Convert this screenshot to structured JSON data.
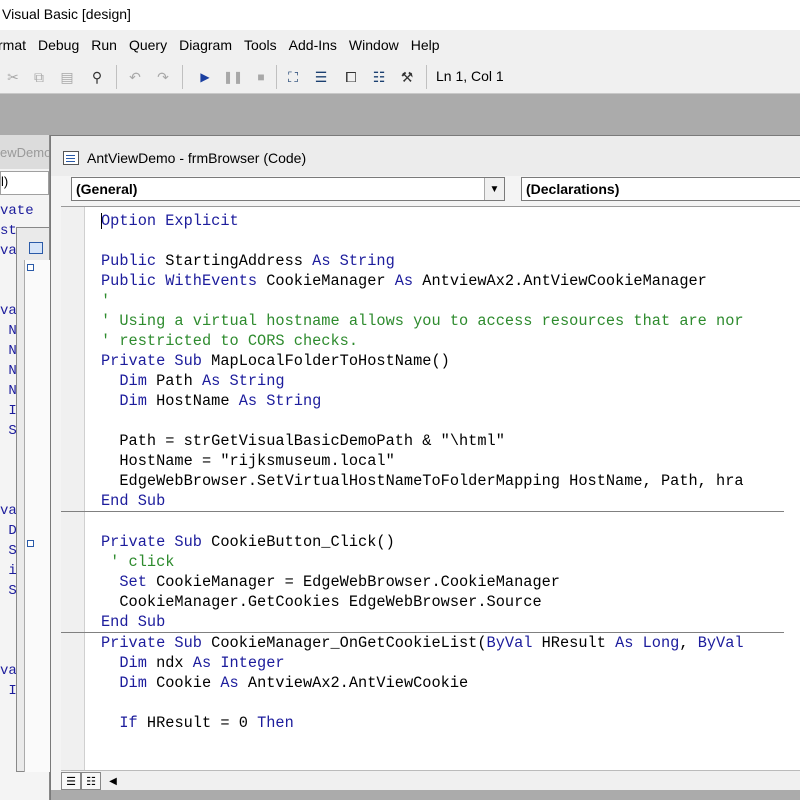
{
  "app": {
    "title": "Visual Basic [design]"
  },
  "menu": [
    "rmat",
    "Debug",
    "Run",
    "Query",
    "Diagram",
    "Tools",
    "Add-Ins",
    "Window",
    "Help"
  ],
  "toolbar": {
    "status": "Ln 1, Col 1",
    "icons": [
      "cut-icon",
      "copy-icon",
      "paste-icon",
      "find-icon",
      "undo-icon",
      "redo-icon",
      "run-icon",
      "pause-icon",
      "stop-icon",
      "project-explorer-icon",
      "properties-window-icon",
      "form-layout-icon",
      "object-browser-icon",
      "toolbox-icon"
    ]
  },
  "bg_window": {
    "title": "ewDemo",
    "combo": "l)",
    "lines": [
      "vate",
      "st",
      "va",
      "",
      "",
      "va",
      " N",
      " N",
      " N",
      " N",
      " I",
      " S",
      "",
      "",
      "",
      "va",
      " D",
      " S",
      " i",
      " S",
      "",
      "",
      "",
      "va",
      " I"
    ]
  },
  "code_window": {
    "title": "AntViewDemo - frmBrowser (Code)",
    "object_combo": "(General)",
    "procedure_combo": "(Declarations)"
  },
  "code_lines": [
    [
      [
        "kw",
        "Option Explicit"
      ]
    ],
    [],
    [
      [
        "kw",
        "Public "
      ],
      [
        "tx",
        "StartingAddress "
      ],
      [
        "kw",
        "As String"
      ]
    ],
    [
      [
        "kw",
        "Public WithEvents "
      ],
      [
        "tx",
        "CookieManager "
      ],
      [
        "kw",
        "As "
      ],
      [
        "tx",
        "AntviewAx2.AntViewCookieManager"
      ]
    ],
    [
      [
        "cm",
        "'"
      ]
    ],
    [
      [
        "cm",
        "' Using a virtual hostname allows you to access resources that are nor"
      ]
    ],
    [
      [
        "cm",
        "' restricted to CORS checks."
      ]
    ],
    [
      [
        "kw",
        "Private Sub "
      ],
      [
        "tx",
        "MapLocalFolderToHostName()"
      ]
    ],
    [
      [
        "tx",
        "  "
      ],
      [
        "kw",
        "Dim "
      ],
      [
        "tx",
        "Path "
      ],
      [
        "kw",
        "As String"
      ]
    ],
    [
      [
        "tx",
        "  "
      ],
      [
        "kw",
        "Dim "
      ],
      [
        "tx",
        "HostName "
      ],
      [
        "kw",
        "As String"
      ]
    ],
    [],
    [
      [
        "tx",
        "  Path = strGetVisualBasicDemoPath & \"\\html\""
      ]
    ],
    [
      [
        "tx",
        "  HostName = \"rijksmuseum.local\""
      ]
    ],
    [
      [
        "tx",
        "  EdgeWebBrowser.SetVirtualHostNameToFolderMapping HostName, Path, hra"
      ]
    ],
    [
      [
        "kw",
        "End Sub"
      ]
    ],
    [
      "SEP"
    ],
    [],
    [
      [
        "kw",
        "Private Sub "
      ],
      [
        "tx",
        "CookieButton_Click()"
      ]
    ],
    [
      [
        "cm",
        " ' click"
      ]
    ],
    [
      [
        "tx",
        "  "
      ],
      [
        "kw",
        "Set "
      ],
      [
        "tx",
        "CookieManager = EdgeWebBrowser.CookieManager"
      ]
    ],
    [
      [
        "tx",
        "  CookieManager.GetCookies EdgeWebBrowser.Source"
      ]
    ],
    [
      [
        "kw",
        "End Sub"
      ]
    ],
    [
      "SEP"
    ],
    [
      [
        "kw",
        "Private Sub "
      ],
      [
        "tx",
        "CookieManager_OnGetCookieList("
      ],
      [
        "kw",
        "ByVal "
      ],
      [
        "tx",
        "HResult "
      ],
      [
        "kw",
        "As Long"
      ],
      [
        "tx",
        ", "
      ],
      [
        "kw",
        "ByVal"
      ]
    ],
    [
      [
        "tx",
        "  "
      ],
      [
        "kw",
        "Dim "
      ],
      [
        "tx",
        "ndx "
      ],
      [
        "kw",
        "As Integer"
      ]
    ],
    [
      [
        "tx",
        "  "
      ],
      [
        "kw",
        "Dim "
      ],
      [
        "tx",
        "Cookie "
      ],
      [
        "kw",
        "As "
      ],
      [
        "tx",
        "AntviewAx2.AntViewCookie"
      ]
    ],
    [],
    [
      [
        "tx",
        "  "
      ],
      [
        "kw",
        "If "
      ],
      [
        "tx",
        "HResult = 0 "
      ],
      [
        "kw",
        "Then"
      ]
    ]
  ],
  "colors": {
    "keyword": "#1c1c9c",
    "comment": "#2e8b2e",
    "workspace": "#ababab"
  }
}
